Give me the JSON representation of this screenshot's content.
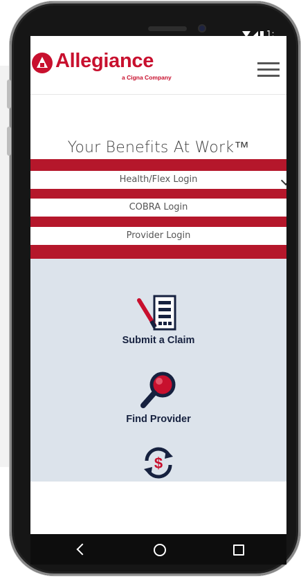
{
  "header": {
    "brand_name": "Allegiance",
    "brand_subtitle": "a Cigna Company",
    "menu_icon": "hamburger-menu-icon"
  },
  "status_bar": {
    "time": "1:"
  },
  "hero": {
    "tagline": "Your Benefits At Work™",
    "logins": [
      {
        "label": "Health/Flex Login",
        "has_dropdown": true
      },
      {
        "label": "COBRA Login",
        "has_dropdown": false
      },
      {
        "label": "Provider Login",
        "has_dropdown": false
      }
    ]
  },
  "features": [
    {
      "label": "Submit a Claim",
      "icon": "submit-claim-icon"
    },
    {
      "label": "Find Provider",
      "icon": "magnifier-search-icon"
    },
    {
      "label": "",
      "icon": "dollar-refresh-icon"
    }
  ],
  "nav": {
    "back": "back-icon",
    "home": "home-icon",
    "recent": "recent-apps-icon"
  },
  "colors": {
    "brand_red": "#c8102e",
    "band_red": "#b5172b",
    "navy": "#16213f",
    "feature_bg": "#dce3eb"
  }
}
